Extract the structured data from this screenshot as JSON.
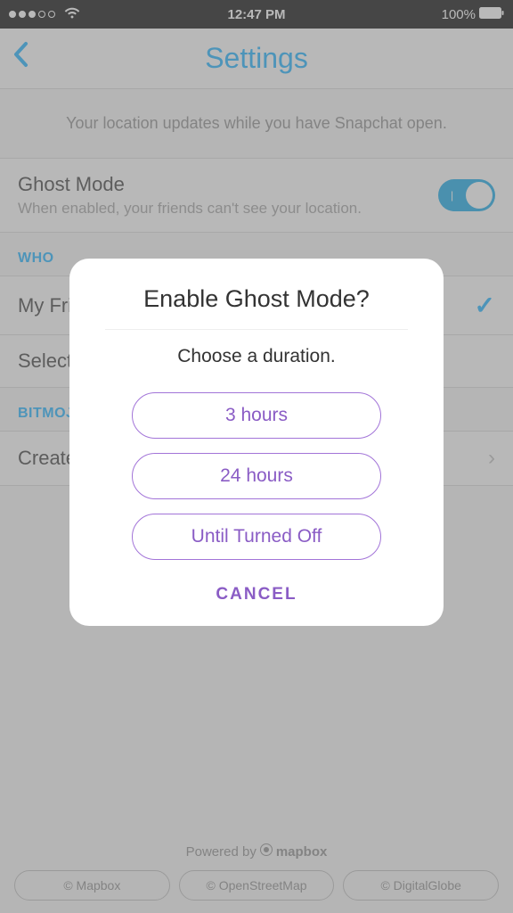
{
  "status_bar": {
    "time": "12:47 PM",
    "battery_percent": "100%"
  },
  "header": {
    "title": "Settings"
  },
  "info_text": "Your location updates while you have Snapchat open.",
  "ghost_mode": {
    "title": "Ghost Mode",
    "subtitle": "When enabled, your friends can't see your location."
  },
  "sections": {
    "who_section_header": "WHO",
    "my_friends_label": "My Friends",
    "select_label": "Select Friends",
    "bitmoji_section_header": "BITMOJI",
    "create_label": "Create Bitmoji"
  },
  "footer": {
    "powered_by_prefix": "Powered by",
    "powered_by_brand": "mapbox",
    "copyrights": [
      "© Mapbox",
      "© OpenStreetMap",
      "© DigitalGlobe"
    ]
  },
  "modal": {
    "title": "Enable Ghost Mode?",
    "subtitle": "Choose a duration.",
    "options": [
      "3 hours",
      "24 hours",
      "Until Turned Off"
    ],
    "cancel": "CANCEL"
  }
}
